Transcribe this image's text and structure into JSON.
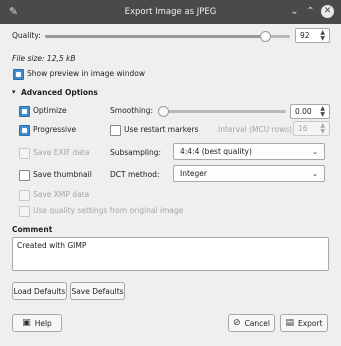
{
  "window": {
    "title": "Export Image as JPEG"
  },
  "quality": {
    "label": "Quality:",
    "value": "92",
    "fraction": 0.92
  },
  "file_size": "File size: 12,5 kB",
  "show_preview": {
    "label": "Show preview in image window",
    "checked": true
  },
  "advanced": {
    "header": "Advanced Options",
    "optimize": {
      "label": "Optimize",
      "checked": true
    },
    "progressive": {
      "label": "Progressive",
      "checked": true
    },
    "save_exif": {
      "label": "Save EXIF data",
      "checked": false,
      "disabled": true
    },
    "save_thumbnail": {
      "label": "Save thumbnail",
      "checked": false
    },
    "save_xmp": {
      "label": "Save XMP data",
      "checked": false,
      "disabled": true
    },
    "use_quality_settings": {
      "label": "Use quality settings from original image",
      "checked": false,
      "disabled": true
    },
    "smoothing": {
      "label": "Smoothing:",
      "value": "0.00",
      "fraction": 0.0
    },
    "restart_markers": {
      "label": "Use restart markers",
      "checked": false
    },
    "interval": {
      "label": "Interval (MCU rows):",
      "value": "16"
    },
    "subsampling": {
      "label": "Subsampling:",
      "value": "4:4:4 (best quality)"
    },
    "dct": {
      "label": "DCT method:",
      "value": "Integer"
    }
  },
  "comment": {
    "label": "Comment",
    "value": "Created with GIMP"
  },
  "buttons": {
    "load_defaults": "Load Defaults",
    "save_defaults": "Save Defaults",
    "help": "Help",
    "cancel": "Cancel",
    "export": "Export"
  },
  "colors": {
    "titlebar": "#4a4a4a",
    "accent": "#3f8fd2",
    "background": "#efefef"
  }
}
